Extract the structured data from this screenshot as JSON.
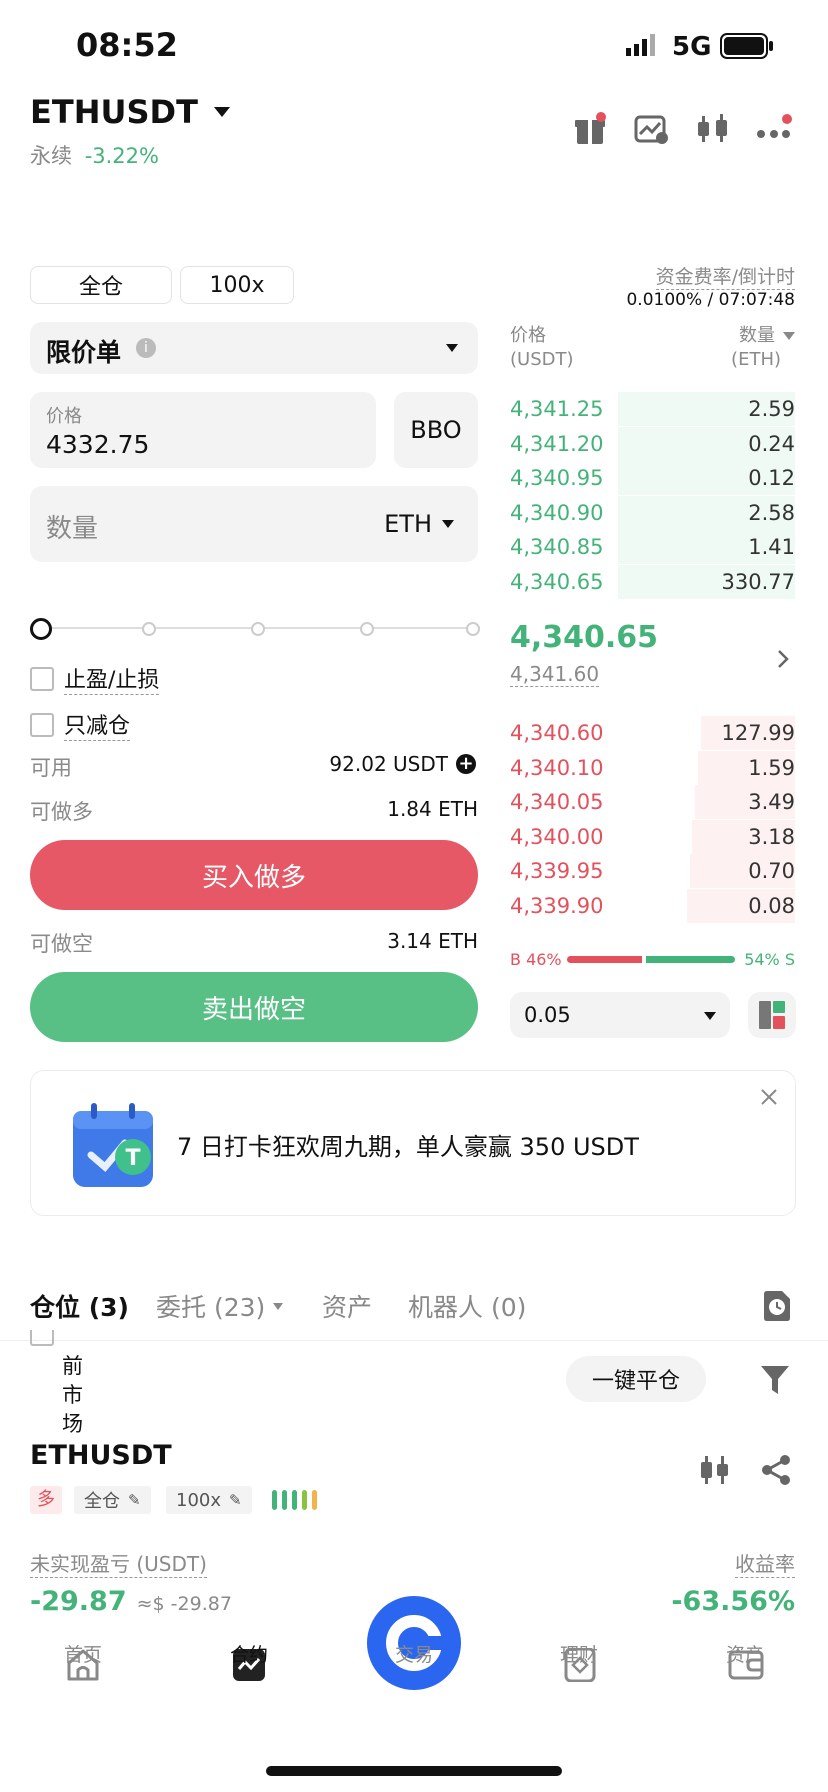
{
  "status_bar": {
    "time": "08:52",
    "network": "5G"
  },
  "header": {
    "symbol": "ETHUSDT",
    "type": "永续",
    "change": "-3.22%",
    "icons": [
      "gift-icon",
      "chart-edit-icon",
      "candlestick-icon",
      "more-icon"
    ]
  },
  "order_panel": {
    "margin_mode": "全仓",
    "leverage": "100x",
    "order_type": "限价单",
    "price_label": "价格",
    "price_value": "4332.75",
    "bbo_label": "BBO",
    "quantity_placeholder": "数量",
    "quantity_unit": "ETH",
    "tp_sl_label": "止盈/止损",
    "reduce_only_label": "只减仓",
    "available_label": "可用",
    "available_value": "92.02 USDT",
    "can_long_label": "可做多",
    "can_long_value": "1.84 ETH",
    "buy_button": "买入做多",
    "can_short_label": "可做空",
    "can_short_value": "3.14 ETH",
    "sell_button": "卖出做空"
  },
  "orderbook": {
    "funding_label": "资金费率/倒计时",
    "funding_value": "0.0100% / 07:07:48",
    "price_header": "价格",
    "price_unit": "(USDT)",
    "qty_header": "数量",
    "qty_unit": "(ETH)",
    "asks": [
      {
        "price": "4,341.25",
        "qty": "2.59",
        "depth": 0.62
      },
      {
        "price": "4,341.20",
        "qty": "0.24",
        "depth": 0.62
      },
      {
        "price": "4,340.95",
        "qty": "0.12",
        "depth": 0.62
      },
      {
        "price": "4,340.90",
        "qty": "2.58",
        "depth": 0.62
      },
      {
        "price": "4,340.85",
        "qty": "1.41",
        "depth": 0.62
      },
      {
        "price": "4,340.65",
        "qty": "330.77",
        "depth": 0.62
      }
    ],
    "last_price": "4,340.65",
    "mark_price": "4,341.60",
    "bids": [
      {
        "price": "4,340.60",
        "qty": "127.99",
        "depth": 0.33
      },
      {
        "price": "4,340.10",
        "qty": "1.59",
        "depth": 0.34
      },
      {
        "price": "4,340.05",
        "qty": "3.49",
        "depth": 0.35
      },
      {
        "price": "4,340.00",
        "qty": "3.18",
        "depth": 0.36
      },
      {
        "price": "4,339.95",
        "qty": "0.70",
        "depth": 0.37
      },
      {
        "price": "4,339.90",
        "qty": "0.08",
        "depth": 0.38
      }
    ],
    "buy_ratio_label": "B 46%",
    "sell_ratio_label": "54% S",
    "buy_ratio": 0.46,
    "precision": "0.05"
  },
  "banner": {
    "text": "7 日打卡狂欢周九期，单人豪赢 350 USDT"
  },
  "tabs": [
    {
      "label": "仓位 (3)"
    },
    {
      "label": "委托 (23)"
    },
    {
      "label": "资产"
    },
    {
      "label": "机器人 (0)"
    }
  ],
  "positions": {
    "current_market_label": "前市场",
    "close_all_button": "一键平仓",
    "symbol": "ETHUSDT",
    "side": "多",
    "margin_mode": "全仓",
    "leverage": "100x",
    "pnl_label": "未实现盈亏 (USDT)",
    "pnl_value": "-29.87",
    "pnl_usd": "≈$ -29.87",
    "roe_label": "收益率",
    "roe_value": "-63.56%"
  },
  "bottom_nav": [
    {
      "label": "首页",
      "icon": "home-icon"
    },
    {
      "label": "合约",
      "icon": "futures-icon"
    },
    {
      "label": "交易",
      "icon": "trade-icon"
    },
    {
      "label": "理财",
      "icon": "earn-icon"
    },
    {
      "label": "资产",
      "icon": "wallet-icon"
    }
  ],
  "colors": {
    "green": "#44b37a",
    "red": "#e2515c",
    "blue": "#2a66f0"
  }
}
